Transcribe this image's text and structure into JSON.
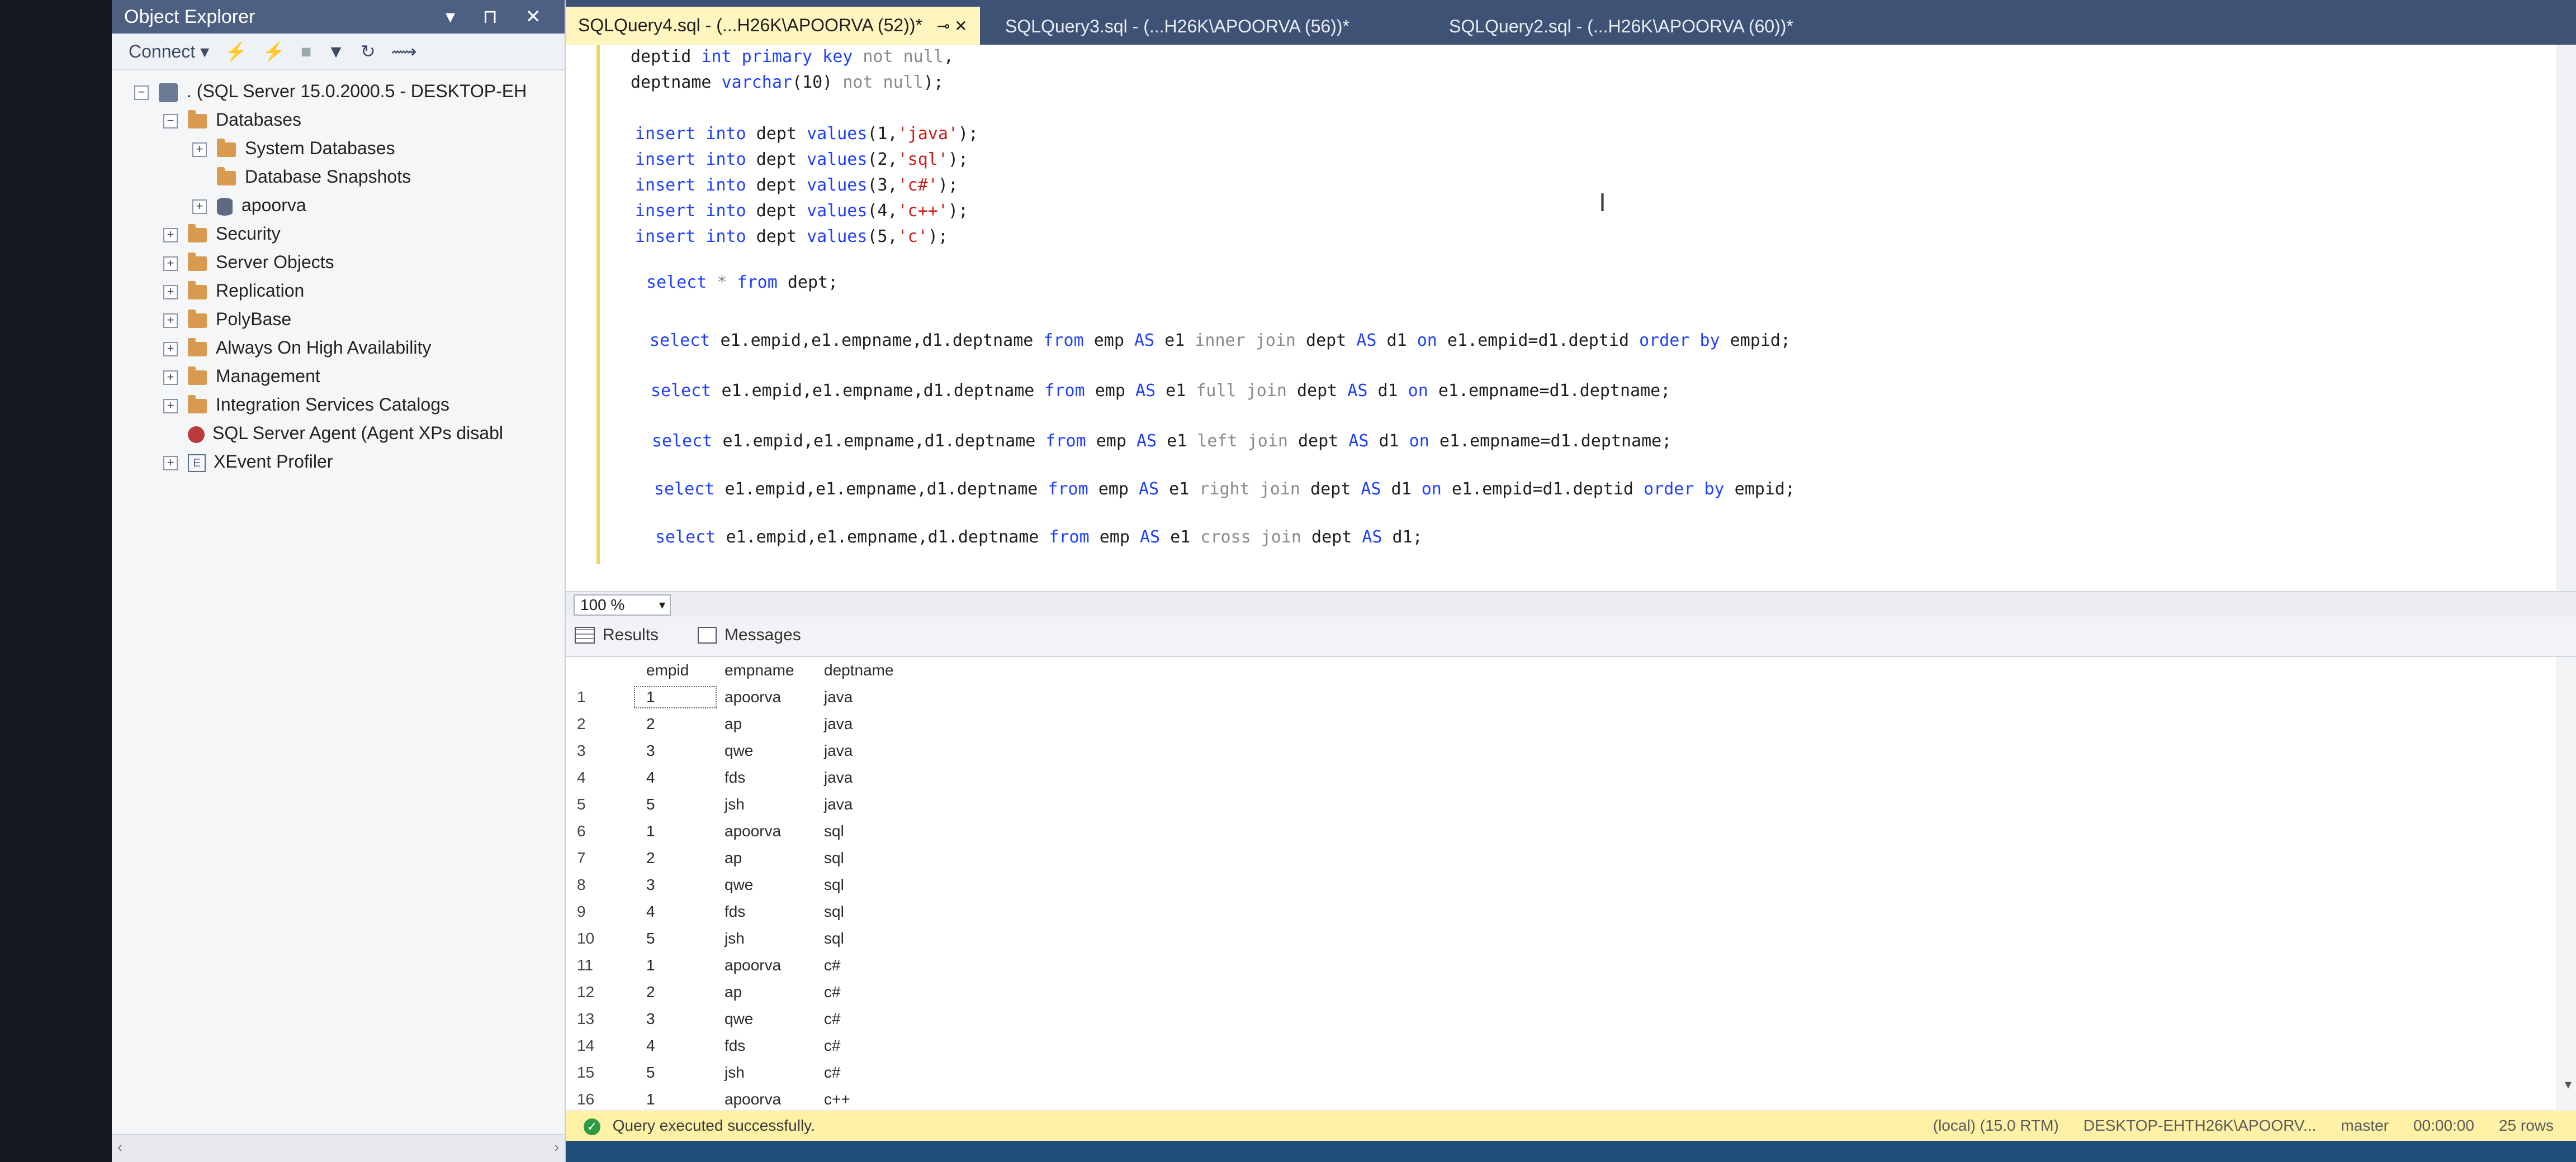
{
  "object_explorer": {
    "title": "Object Explorer",
    "title_buttons": "▾ ⊓ ✕",
    "connect_label": "Connect ▾",
    "tree": [
      {
        "label": ". (SQL Server 15.0.2000.5 - DESKTOP-EH",
        "indent": 0,
        "exp": "−",
        "icon": "server"
      },
      {
        "label": "Databases",
        "indent": 1,
        "exp": "−",
        "icon": "folder"
      },
      {
        "label": "System Databases",
        "indent": 2,
        "exp": "+",
        "icon": "folder"
      },
      {
        "label": "Database Snapshots",
        "indent": 2,
        "exp": "",
        "icon": "folder"
      },
      {
        "label": "apoorva",
        "indent": 2,
        "exp": "+",
        "icon": "database"
      },
      {
        "label": "Security",
        "indent": 1,
        "exp": "+",
        "icon": "folder"
      },
      {
        "label": "Server Objects",
        "indent": 1,
        "exp": "+",
        "icon": "folder"
      },
      {
        "label": "Replication",
        "indent": 1,
        "exp": "+",
        "icon": "folder"
      },
      {
        "label": "PolyBase",
        "indent": 1,
        "exp": "+",
        "icon": "folder"
      },
      {
        "label": "Always On High Availability",
        "indent": 1,
        "exp": "+",
        "icon": "folder"
      },
      {
        "label": "Management",
        "indent": 1,
        "exp": "+",
        "icon": "folder"
      },
      {
        "label": "Integration Services Catalogs",
        "indent": 1,
        "exp": "+",
        "icon": "folder"
      },
      {
        "label": "SQL Server Agent (Agent XPs disabl",
        "indent": 1,
        "exp": "",
        "icon": "agent"
      },
      {
        "label": "XEvent Profiler",
        "indent": 1,
        "exp": "+",
        "icon": "xevent"
      }
    ]
  },
  "tabs": [
    {
      "label": "SQLQuery4.sql - (...H26K\\APOORVA (52))*",
      "active": true,
      "pin": "⊸ ✕"
    },
    {
      "label": "SQLQuery3.sql - (...H26K\\APOORVA (56))*",
      "active": false
    },
    {
      "label": "SQLQuery2.sql - (...H26K\\APOORVA (60))*",
      "active": false
    }
  ],
  "editor": {
    "lines": [
      [
        [
          "deptid ",
          ""
        ],
        [
          "int primary key ",
          "kw"
        ],
        [
          "not null",
          "gy"
        ],
        [
          ",",
          ""
        ]
      ],
      [
        [
          "deptname ",
          ""
        ],
        [
          "varchar",
          "kw"
        ],
        [
          "(10) ",
          ""
        ],
        [
          "not null",
          "gy"
        ],
        [
          ");",
          ""
        ]
      ],
      [],
      [
        [
          "insert into ",
          "kw"
        ],
        [
          "dept ",
          ""
        ],
        [
          "values",
          "kw"
        ],
        [
          "(1,",
          ""
        ],
        [
          "'java'",
          "st"
        ],
        [
          ");",
          ""
        ]
      ],
      [
        [
          "insert into ",
          "kw"
        ],
        [
          "dept ",
          ""
        ],
        [
          "values",
          "kw"
        ],
        [
          "(2,",
          ""
        ],
        [
          "'sql'",
          "st"
        ],
        [
          ");",
          ""
        ]
      ],
      [
        [
          "insert into ",
          "kw"
        ],
        [
          "dept ",
          ""
        ],
        [
          "values",
          "kw"
        ],
        [
          "(3,",
          ""
        ],
        [
          "'c#'",
          "st"
        ],
        [
          ");",
          ""
        ]
      ],
      [
        [
          "insert into ",
          "kw"
        ],
        [
          "dept ",
          ""
        ],
        [
          "values",
          "kw"
        ],
        [
          "(4,",
          ""
        ],
        [
          "'c++'",
          "st"
        ],
        [
          ");",
          ""
        ]
      ],
      [
        [
          "insert into ",
          "kw"
        ],
        [
          "dept ",
          ""
        ],
        [
          "values",
          "kw"
        ],
        [
          "(5,",
          ""
        ],
        [
          "'c'",
          "st"
        ],
        [
          ");",
          ""
        ]
      ],
      [],
      [
        [
          "select ",
          "kw"
        ],
        [
          "* ",
          "gy"
        ],
        [
          "from ",
          "kw"
        ],
        [
          "dept;",
          ""
        ]
      ],
      [],
      [
        [
          "select ",
          "kw"
        ],
        [
          "e1.empid,e1.empname,d1.deptname ",
          ""
        ],
        [
          "from ",
          "kw"
        ],
        [
          "emp ",
          ""
        ],
        [
          "AS ",
          "kw"
        ],
        [
          "e1 ",
          ""
        ],
        [
          "inner join ",
          "gy"
        ],
        [
          "dept ",
          ""
        ],
        [
          "AS ",
          "kw"
        ],
        [
          "d1 ",
          ""
        ],
        [
          "on ",
          "kw"
        ],
        [
          "e1.empid=d1.deptid ",
          ""
        ],
        [
          "order by ",
          "kw"
        ],
        [
          "empid;",
          ""
        ]
      ],
      [],
      [
        [
          "select ",
          "kw"
        ],
        [
          "e1.empid,e1.empname,d1.deptname ",
          ""
        ],
        [
          "from ",
          "kw"
        ],
        [
          "emp ",
          ""
        ],
        [
          "AS ",
          "kw"
        ],
        [
          "e1 ",
          ""
        ],
        [
          "full join ",
          "gy"
        ],
        [
          "dept ",
          ""
        ],
        [
          "AS ",
          "kw"
        ],
        [
          "d1 ",
          ""
        ],
        [
          "on ",
          "kw"
        ],
        [
          "e1.empname=d1.deptname;",
          ""
        ]
      ],
      [],
      [
        [
          "select ",
          "kw"
        ],
        [
          "e1.empid,e1.empname,d1.deptname ",
          ""
        ],
        [
          "from ",
          "kw"
        ],
        [
          "emp ",
          ""
        ],
        [
          "AS ",
          "kw"
        ],
        [
          "e1 ",
          ""
        ],
        [
          "left join ",
          "gy"
        ],
        [
          "dept ",
          ""
        ],
        [
          "AS ",
          "kw"
        ],
        [
          "d1 ",
          ""
        ],
        [
          "on ",
          "kw"
        ],
        [
          "e1.empname=d1.deptname;",
          ""
        ]
      ],
      [],
      [
        [
          "select ",
          "kw"
        ],
        [
          "e1.empid,e1.empname,d1.deptname ",
          ""
        ],
        [
          "from ",
          "kw"
        ],
        [
          "emp ",
          ""
        ],
        [
          "AS ",
          "kw"
        ],
        [
          "e1 ",
          ""
        ],
        [
          "right join ",
          "gy"
        ],
        [
          "dept ",
          ""
        ],
        [
          "AS ",
          "kw"
        ],
        [
          "d1 ",
          ""
        ],
        [
          "on ",
          "kw"
        ],
        [
          "e1.empid=d1.deptid ",
          ""
        ],
        [
          "order by ",
          "kw"
        ],
        [
          "empid;",
          ""
        ]
      ],
      [],
      [
        [
          "select ",
          "kw"
        ],
        [
          "e1.empid,e1.empname,d1.deptname ",
          ""
        ],
        [
          "from ",
          "kw"
        ],
        [
          "emp ",
          ""
        ],
        [
          "AS ",
          "kw"
        ],
        [
          "e1 ",
          ""
        ],
        [
          "cross join ",
          "gy"
        ],
        [
          "dept ",
          ""
        ],
        [
          "AS ",
          "kw"
        ],
        [
          "d1;",
          ""
        ]
      ]
    ],
    "zoom": "100 %"
  },
  "results": {
    "tab_results": "Results",
    "tab_messages": "Messages",
    "columns": [
      "empid",
      "empname",
      "deptname"
    ],
    "rows": [
      [
        "1",
        "1",
        "apoorva",
        "java"
      ],
      [
        "2",
        "2",
        "ap",
        "java"
      ],
      [
        "3",
        "3",
        "qwe",
        "java"
      ],
      [
        "4",
        "4",
        "fds",
        "java"
      ],
      [
        "5",
        "5",
        "jsh",
        "java"
      ],
      [
        "6",
        "1",
        "apoorva",
        "sql"
      ],
      [
        "7",
        "2",
        "ap",
        "sql"
      ],
      [
        "8",
        "3",
        "qwe",
        "sql"
      ],
      [
        "9",
        "4",
        "fds",
        "sql"
      ],
      [
        "10",
        "5",
        "jsh",
        "sql"
      ],
      [
        "11",
        "1",
        "apoorva",
        "c#"
      ],
      [
        "12",
        "2",
        "ap",
        "c#"
      ],
      [
        "13",
        "3",
        "qwe",
        "c#"
      ],
      [
        "14",
        "4",
        "fds",
        "c#"
      ],
      [
        "15",
        "5",
        "jsh",
        "c#"
      ],
      [
        "16",
        "1",
        "apoorva",
        "c++"
      ]
    ]
  },
  "status": {
    "message": "Query executed successfully.",
    "server": "(local) (15.0 RTM)",
    "user": "DESKTOP-EHTH26K\\APOORV...",
    "database": "master",
    "time": "00:00:00",
    "rows": "25 rows"
  },
  "colors": {
    "title_bar": "#4d6082",
    "tab_bar": "#3e5275",
    "active_tab": "#fff6bf",
    "keyword": "#1f3fff",
    "string": "#c9201c",
    "status_bar": "#fff1a6"
  }
}
